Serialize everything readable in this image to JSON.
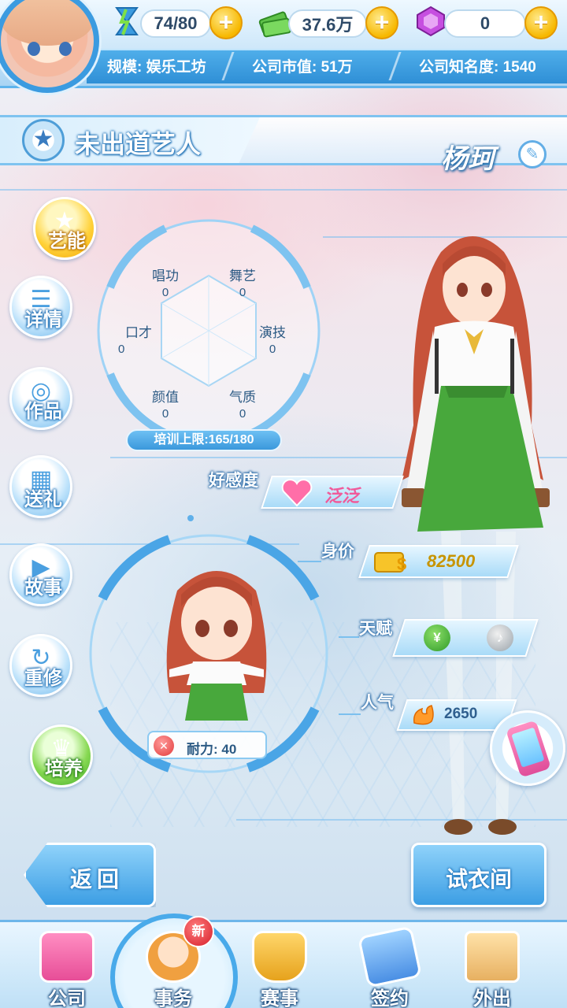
{
  "resources": {
    "energy": "74/80",
    "money": "37.6万",
    "gems": "0"
  },
  "company": {
    "scale": "规模: 娱乐工坊",
    "market_value": "公司市值: 51万",
    "fame": "公司知名度: 1540"
  },
  "header": {
    "title": "未出道艺人",
    "artist_name": "杨珂"
  },
  "side_menu": [
    {
      "label": "艺能"
    },
    {
      "label": "详情"
    },
    {
      "label": "作品"
    },
    {
      "label": "送礼"
    },
    {
      "label": "故事"
    },
    {
      "label": "重修"
    },
    {
      "label": "培养"
    }
  ],
  "skills": {
    "sing": {
      "label": "唱功",
      "value": "0"
    },
    "dance": {
      "label": "舞艺",
      "value": "0"
    },
    "eloquence": {
      "label": "口才",
      "value": "0"
    },
    "acting": {
      "label": "演技",
      "value": "0"
    },
    "looks": {
      "label": "颜值",
      "value": "0"
    },
    "temperament": {
      "label": "气质",
      "value": "0"
    }
  },
  "training_cap": "培训上限:165/180",
  "info": {
    "favor_label": "好感度",
    "favor_value": "泛泛",
    "price_label": "身价",
    "price_value": "82500",
    "talent_label": "天赋",
    "popularity_label": "人气",
    "popularity_value": "2650"
  },
  "stamina": "耐力: 40",
  "buttons": {
    "back": "返回",
    "fitting_room": "试衣间"
  },
  "nav": {
    "items": [
      {
        "label": "公司"
      },
      {
        "label": "事务"
      },
      {
        "label": "赛事"
      },
      {
        "label": "签约"
      },
      {
        "label": "外出"
      }
    ],
    "new_badge": "新"
  },
  "colors": {
    "accent": "#3c9ee4",
    "gold": "#f7b800",
    "favor": "#f05a9a",
    "price": "#c79400"
  }
}
